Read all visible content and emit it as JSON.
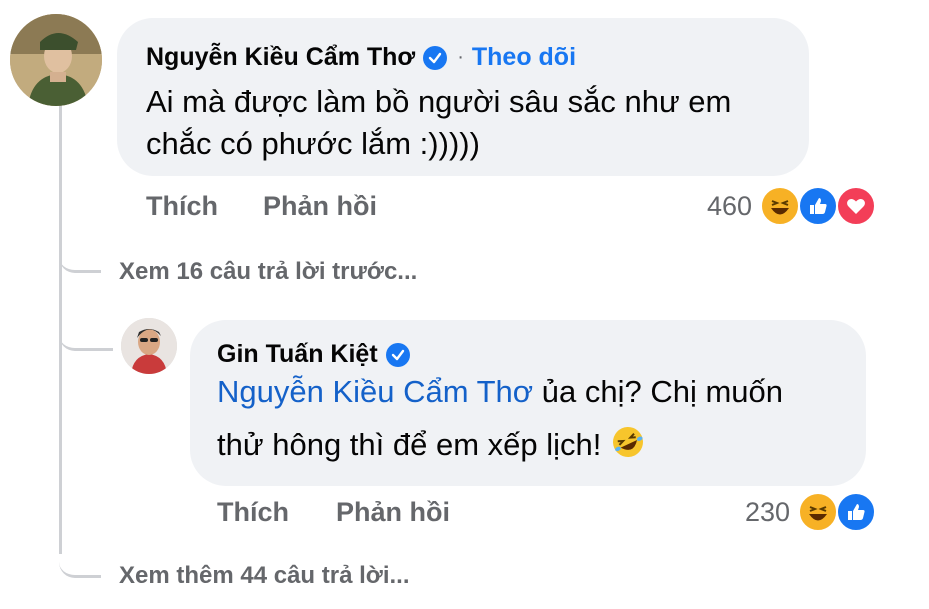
{
  "comment1": {
    "author": "Nguyễn Kiều Cẩm Thơ",
    "follow_label": "Theo dõi",
    "dot": "·",
    "line1": "Ai mà được làm bồ người sâu sắc như em",
    "line2": "chắc có phước lắm :)))))",
    "like_label": "Thích",
    "reply_label": "Phản hồi",
    "reaction_count": "460",
    "reactions": [
      "haha-icon",
      "like-icon",
      "love-icon"
    ]
  },
  "view_previous": "Xem 16 câu trả lời trước...",
  "reply1": {
    "author": "Gin Tuấn Kiệt",
    "mention": "Nguyễn Kiều Cẩm Thơ",
    "line1_rest": " ủa chị? Chị muốn",
    "line2": "thử hông thì để em xếp lịch! ",
    "emoji": "🤣",
    "like_label": "Thích",
    "reply_label": "Phản hồi",
    "reaction_count": "230",
    "reactions": [
      "haha-icon",
      "like-icon"
    ]
  },
  "view_more": "Xem thêm 44 câu trả lời...",
  "colors": {
    "bubble": "#f0f2f5",
    "link_blue": "#1877f2",
    "mention_blue": "#1461c9",
    "secondary_text": "#65676b",
    "love_red": "#f33e58",
    "haha_yellow": "#f7b125"
  }
}
